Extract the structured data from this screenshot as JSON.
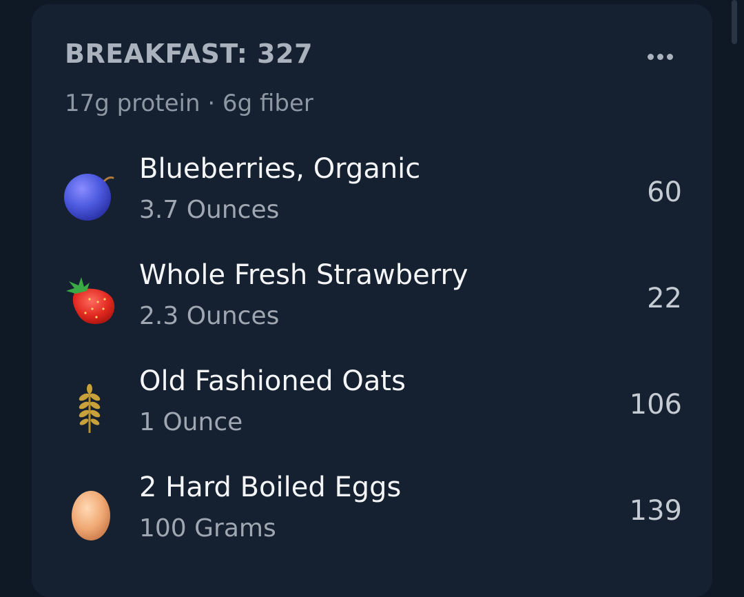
{
  "meal": {
    "title": "BREAKFAST: 327",
    "macros": "17g protein · 6g fiber",
    "more_icon": "ellipsis-icon"
  },
  "colors": {
    "background": "#0f1825",
    "card": "#152030",
    "title": "#a9b2bd",
    "food_name": "#f4f6f8",
    "secondary": "#9ea7b2"
  },
  "foods": [
    {
      "name": "Blueberries, Organic",
      "quantity": "3.7 Ounces",
      "calories": "60",
      "icon": "blueberry-icon"
    },
    {
      "name": "Whole Fresh Strawberry",
      "quantity": "2.3 Ounces",
      "calories": "22",
      "icon": "strawberry-icon"
    },
    {
      "name": "Old Fashioned Oats",
      "quantity": "1 Ounce",
      "calories": "106",
      "icon": "wheat-icon"
    },
    {
      "name": "2 Hard Boiled Eggs",
      "quantity": "100 Grams",
      "calories": "139",
      "icon": "egg-icon"
    }
  ]
}
